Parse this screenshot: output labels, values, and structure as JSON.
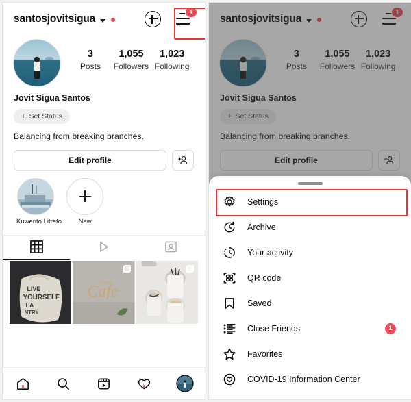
{
  "profile": {
    "username": "santosjovitsigua",
    "fullname": "Jovit Sigua Santos",
    "bio": "Balancing from breaking branches.",
    "status_chip": "Set Status",
    "status_plus": "+",
    "stats": [
      {
        "number": "3",
        "label": "Posts"
      },
      {
        "number": "1,055",
        "label": "Followers"
      },
      {
        "number": "1,023",
        "label": "Following"
      }
    ],
    "edit_profile": "Edit profile",
    "menu_badge": "1"
  },
  "highlights": [
    {
      "label": "Kuwento Litrato",
      "type": "story"
    },
    {
      "label": "New",
      "type": "new"
    }
  ],
  "tabs": [
    {
      "name": "grid-tab",
      "icon": "grid-icon",
      "active": true
    },
    {
      "name": "reels-tab",
      "icon": "play-icon",
      "active": false
    },
    {
      "name": "tagged-tab",
      "icon": "tagged-person-icon",
      "active": false
    }
  ],
  "posts": [
    {
      "alt": "tote-bag-post",
      "multi": false
    },
    {
      "alt": "cafe-neon-sign-post",
      "multi": true
    },
    {
      "alt": "iced-drinks-post",
      "multi": true
    }
  ],
  "bottom_nav": [
    {
      "name": "home-icon",
      "dot": true
    },
    {
      "name": "search-icon",
      "dot": false
    },
    {
      "name": "reels-icon",
      "dot": false
    },
    {
      "name": "heart-icon",
      "dot": true
    },
    {
      "name": "profile-avatar",
      "dot": false
    }
  ],
  "sheet_menu": [
    {
      "label": "Settings",
      "icon": "gear-icon",
      "badge": "",
      "highlighted": true
    },
    {
      "label": "Archive",
      "icon": "archive-clock-icon",
      "badge": "",
      "highlighted": false
    },
    {
      "label": "Your activity",
      "icon": "activity-clock-icon",
      "badge": "",
      "highlighted": false
    },
    {
      "label": "QR code",
      "icon": "qr-code-icon",
      "badge": "",
      "highlighted": false
    },
    {
      "label": "Saved",
      "icon": "bookmark-icon",
      "badge": "",
      "highlighted": false
    },
    {
      "label": "Close Friends",
      "icon": "close-friends-list-icon",
      "badge": "1",
      "highlighted": false
    },
    {
      "label": "Favorites",
      "icon": "star-icon",
      "badge": "",
      "highlighted": false
    },
    {
      "label": "COVID-19 Information Center",
      "icon": "covid-info-icon",
      "badge": "",
      "highlighted": false
    }
  ],
  "colors": {
    "accent_red": "#ed4956",
    "highlight_box": "#e8352e",
    "text_primary": "#111111",
    "text_secondary": "#373737"
  }
}
